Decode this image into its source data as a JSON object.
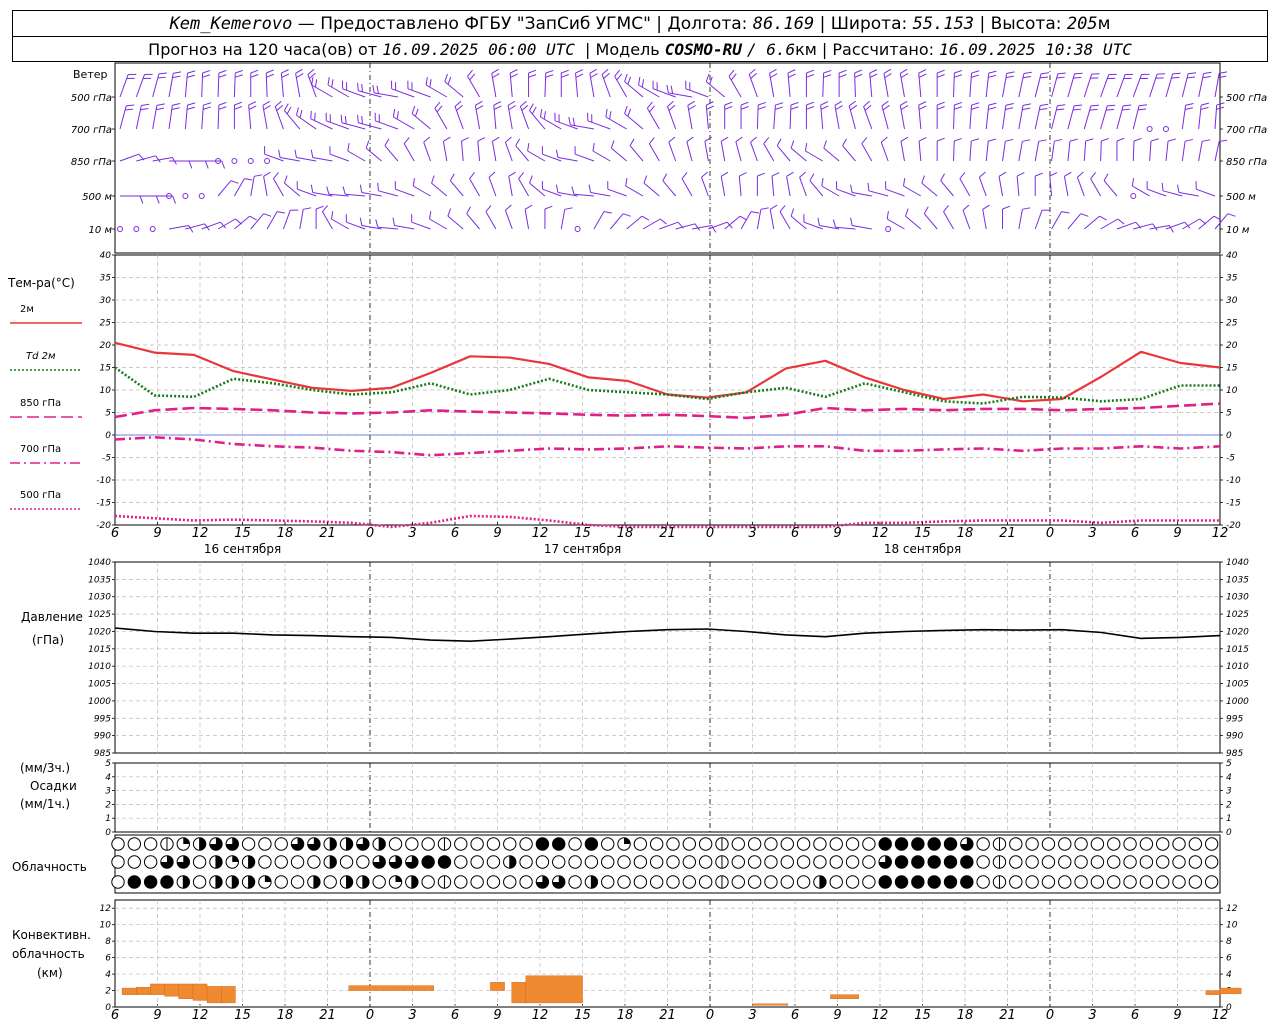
{
  "header": {
    "station": "Kem_Kemerovo",
    "provider": "— Предоставлено ФГБУ \"ЗапСиб УГМС\"",
    "lon_label": "Долгота:",
    "lon": "86.169",
    "lat_label": "Широта:",
    "lat": "55.153",
    "alt_label": "Высота:",
    "alt": "205",
    "alt_unit": "м",
    "forecast_label": "Прогноз на 120 часа(ов) от",
    "init_time": "16.09.2025 06:00 UTC",
    "model_label": "Модель",
    "model": "COSMO-RU",
    "resolution": "/ 6.6",
    "res_unit": "км",
    "computed_label": "Рассчитано:",
    "computed_time": "16.09.2025 10:38 UTC"
  },
  "wind_panel": {
    "title": "Ветер",
    "levels": [
      "500 гПа",
      "700 гПа",
      "850 гПа",
      "500 м",
      "10 м"
    ],
    "color": "#7b2be0",
    "calm_marker": "circle"
  },
  "temp_panel": {
    "title": "Тем-ра(°C)",
    "legend": [
      {
        "label": "2м",
        "color": "#e8363b",
        "style": "solid"
      },
      {
        "label": "Td  2м",
        "color": "#1a7a1a",
        "style": "dotted"
      },
      {
        "label": "850 гПа",
        "color": "#e0208a",
        "style": "dashed"
      },
      {
        "label": "700 гПа",
        "color": "#e0208a",
        "style": "dashdot"
      },
      {
        "label": "500 гПа",
        "color": "#e0208a",
        "style": "dotted"
      }
    ],
    "y_ticks": [
      "40",
      "35",
      "30",
      "25",
      "20",
      "15",
      "10",
      "5",
      "0",
      "-5",
      "-10",
      "-15",
      "-20"
    ]
  },
  "pressure_panel": {
    "title": "Давление",
    "unit": "(гПа)",
    "y_ticks": [
      "1040",
      "1035",
      "1030",
      "1025",
      "1020",
      "1015",
      "1010",
      "1005",
      "1000",
      "995",
      "990",
      "985"
    ]
  },
  "precip_panel": {
    "label_top": "(мм/3ч.)",
    "title": "Осадки",
    "label_bottom": "(мм/1ч.)",
    "y_ticks": [
      "5",
      "4",
      "3",
      "2",
      "1",
      "0"
    ]
  },
  "cloud_panel": {
    "title": "Облачность"
  },
  "convective_panel": {
    "title_1": "Конвективн.",
    "title_2": "облачность",
    "unit": "(км)",
    "y_ticks": [
      "12",
      "10",
      "8",
      "6",
      "4",
      "2",
      "0"
    ],
    "color": "#f08a30"
  },
  "x_axis": {
    "tick_labels": [
      "6",
      "9",
      "12",
      "15",
      "18",
      "21",
      "0",
      "3",
      "6",
      "9",
      "12",
      "15",
      "18",
      "21",
      "0",
      "3",
      "6",
      "9",
      "12",
      "15",
      "18",
      "21",
      "0",
      "3",
      "6",
      "9",
      "12"
    ],
    "day_labels": [
      "16 сентября",
      "17 сентября",
      "18 сентября"
    ]
  },
  "chart_data": {
    "type": "line",
    "x_hours_from_init": [
      0,
      3,
      6,
      9,
      12,
      15,
      18,
      21,
      24,
      27,
      30,
      33,
      36,
      39,
      42,
      45,
      48,
      51,
      54,
      57,
      60,
      63,
      66,
      69,
      72,
      75,
      78
    ],
    "time_axis_hours_utc": [
      "6",
      "9",
      "12",
      "15",
      "18",
      "21",
      "0",
      "3",
      "6",
      "9",
      "12",
      "15",
      "18",
      "21",
      "0",
      "3",
      "6",
      "9",
      "12",
      "15",
      "18",
      "21",
      "0",
      "3",
      "6",
      "9",
      "12"
    ],
    "series": [
      {
        "name": "2м",
        "unit": "°C",
        "values": [
          20.5,
          18.3,
          17.8,
          14.2,
          12.3,
          10.5,
          9.8,
          10.5,
          13.8,
          17.5,
          17.2,
          15.8,
          12.8,
          12.0,
          9.0,
          8.3,
          9.5,
          14.8,
          16.5,
          12.8,
          10.0,
          8.0,
          9.0,
          7.5,
          8.0,
          13.0,
          18.5,
          16.0,
          15.0
        ]
      },
      {
        "name": "Td  2м",
        "unit": "°C",
        "values": [
          15.0,
          8.8,
          8.5,
          12.5,
          11.5,
          10.0,
          9.0,
          9.5,
          11.5,
          9.0,
          10.0,
          12.5,
          10.0,
          9.5,
          9.0,
          8.0,
          9.5,
          10.5,
          8.5,
          11.5,
          9.5,
          7.5,
          7.0,
          8.5,
          8.3,
          7.5,
          8.0,
          11.0,
          11.0
        ]
      },
      {
        "name": "850 гПа",
        "unit": "°C",
        "values": [
          4.0,
          5.5,
          6.0,
          5.8,
          5.5,
          5.0,
          4.8,
          5.0,
          5.5,
          5.2,
          5.0,
          4.8,
          4.5,
          4.3,
          4.5,
          4.2,
          3.8,
          4.5,
          6.0,
          5.5,
          5.8,
          5.5,
          5.8,
          5.8,
          5.5,
          5.8,
          6.0,
          6.5,
          7.0
        ]
      },
      {
        "name": "700 гПа",
        "unit": "°C",
        "values": [
          -1.0,
          -0.5,
          -1.0,
          -2.0,
          -2.5,
          -2.8,
          -3.5,
          -3.8,
          -4.5,
          -4.0,
          -3.5,
          -3.0,
          -3.2,
          -3.0,
          -2.5,
          -2.8,
          -3.0,
          -2.5,
          -2.5,
          -3.5,
          -3.5,
          -3.2,
          -3.0,
          -3.5,
          -3.0,
          -3.0,
          -2.5,
          -3.0,
          -2.5
        ]
      },
      {
        "name": "500 гПа",
        "unit": "°C",
        "values": [
          -18.0,
          -18.5,
          -19.0,
          -18.8,
          -19.0,
          -19.2,
          -19.5,
          -20.5,
          -19.5,
          -18.0,
          -18.2,
          -19.0,
          -20.0,
          -21.0,
          -21.5,
          -21.5,
          -21.0,
          -21.0,
          -20.5,
          -19.5,
          -19.5,
          -19.2,
          -19.0,
          -19.0,
          -19.0,
          -19.5,
          -19.0,
          -19.0,
          -19.0
        ]
      },
      {
        "name": "Давление",
        "unit": "гПа",
        "values": [
          1021.0,
          1020.0,
          1019.5,
          1019.5,
          1019.0,
          1018.8,
          1018.5,
          1018.3,
          1017.5,
          1017.2,
          1017.8,
          1018.5,
          1019.3,
          1020.0,
          1020.5,
          1020.7,
          1020.0,
          1019.0,
          1018.5,
          1019.5,
          1020.0,
          1020.3,
          1020.5,
          1020.4,
          1020.5,
          1019.7,
          1018.0,
          1018.3,
          1018.8
        ]
      }
    ],
    "y_ranges": {
      "temperature": [
        -20,
        40
      ],
      "pressure": [
        985,
        1040
      ],
      "precipitation": [
        0,
        5
      ],
      "convective_cloud_km": [
        0,
        13
      ]
    },
    "precipitation": [],
    "cloud_cover_cells": {
      "note_levels": [
        "high",
        "mid",
        "low"
      ],
      "cells_per_row": 68
    },
    "convective_cloud": [
      {
        "from_h": 0.5,
        "to_h": 1.5,
        "base_km": 1.5,
        "top_km": 2.3
      },
      {
        "from_h": 1.5,
        "to_h": 2.5,
        "base_km": 1.5,
        "top_km": 2.4
      },
      {
        "from_h": 2.5,
        "to_h": 3.5,
        "base_km": 1.5,
        "top_km": 2.8
      },
      {
        "from_h": 3.5,
        "to_h": 4.5,
        "base_km": 1.3,
        "top_km": 2.8
      },
      {
        "from_h": 4.5,
        "to_h": 5.5,
        "base_km": 1.0,
        "top_km": 2.8
      },
      {
        "from_h": 5.5,
        "to_h": 6.5,
        "base_km": 0.8,
        "top_km": 2.8
      },
      {
        "from_h": 6.5,
        "to_h": 7.5,
        "base_km": 0.5,
        "top_km": 2.5
      },
      {
        "from_h": 7.5,
        "to_h": 8.5,
        "base_km": 0.5,
        "top_km": 2.5
      },
      {
        "from_h": 16.5,
        "to_h": 22.5,
        "base_km": 2.0,
        "top_km": 2.6
      },
      {
        "from_h": 26.5,
        "to_h": 27.5,
        "base_km": 2.0,
        "top_km": 3.0
      },
      {
        "from_h": 28.0,
        "to_h": 29.0,
        "base_km": 0.5,
        "top_km": 3.0
      },
      {
        "from_h": 29.0,
        "to_h": 33.0,
        "base_km": 0.5,
        "top_km": 3.8
      },
      {
        "from_h": 45.0,
        "to_h": 47.5,
        "base_km": 0.2,
        "top_km": 0.4
      },
      {
        "from_h": 50.5,
        "to_h": 52.5,
        "base_km": 1.0,
        "top_km": 1.5
      },
      {
        "from_h": 77.0,
        "to_h": 78.0,
        "base_km": 1.5,
        "top_km": 2.0
      },
      {
        "from_h": 78.0,
        "to_h": 79.5,
        "base_km": 1.6,
        "top_km": 2.3
      }
    ]
  }
}
